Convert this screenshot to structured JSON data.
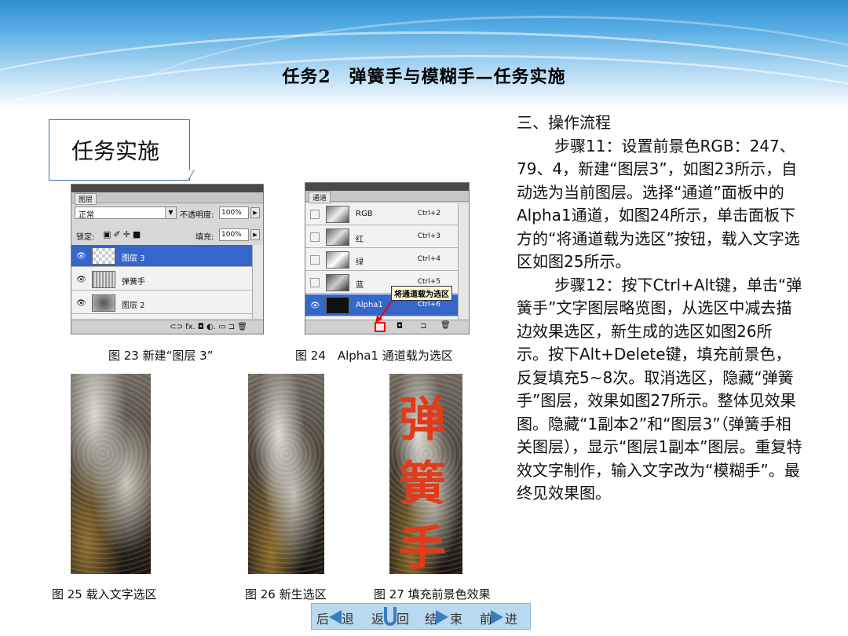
{
  "slide": {
    "title": "任务2　弹簧手与模糊手—任务实施",
    "callout": "任务实施"
  },
  "layers_panel": {
    "tab": "图层",
    "blend_mode": "正常",
    "opacity_label": "不透明度:",
    "opacity_value": "100%",
    "lock_label": "锁定:",
    "fill_label": "填充:",
    "fill_value": "100%",
    "layers": [
      {
        "name": "图层 3",
        "selected": true
      },
      {
        "name": "弹簧手",
        "selected": false
      },
      {
        "name": "图层 2",
        "selected": false
      }
    ],
    "bottom_icons": "⊂⊃ fx. ◘ ◐. ▭ ⊐ 🗑"
  },
  "channels_panel": {
    "tab": "通道",
    "channels": [
      {
        "name": "RGB",
        "shortcut": "Ctrl+2"
      },
      {
        "name": "红",
        "shortcut": "Ctrl+3"
      },
      {
        "name": "绿",
        "shortcut": "Ctrl+4"
      },
      {
        "name": "蓝",
        "shortcut": "Ctrl+5"
      },
      {
        "name": "Alpha1",
        "shortcut": "Ctrl+6",
        "selected": true
      }
    ],
    "tooltip": "将通道载为选区"
  },
  "captions": {
    "fig23": "图 23  新建“图层 3”",
    "fig24": "图 24　Alpha1 通道载为选区",
    "fig25": "图 25 载入文字选区",
    "fig26": "图 26 新生选区",
    "fig27": "图 27 填充前景色效果"
  },
  "fig27_chars": [
    "弹",
    "簧",
    "手"
  ],
  "body": {
    "heading": "三、操作流程",
    "step11": "步骤11：设置前景色RGB：247、79、4，新建“图层3”，如图23所示，自动选为当前图层。选择“通道”面板中的Alpha1通道，如图24所示，单击面板下方的“将通道载为选区”按钮，载入文字选区如图25所示。",
    "step12": "步骤12：按下Ctrl+Alt键，单击“弹簧手”文字图层略览图，从选区中减去描边效果选区，新生成的选区如图26所示。按下Alt+Delete键，填充前景色，反复填充5~8次。取消选区，隐藏“弹簧手”图层，效果如图27所示。整体见效果图。隐藏“1副本2”和“图层3”（弹簧手相关图层），显示“图层1副本”图层。重复特效文字制作，输入文字改为“模糊手”。最终见效果图。"
  },
  "nav": {
    "back": "后　退",
    "return": "返　回",
    "end": "结　束",
    "forward": "前　进"
  },
  "colors": {
    "fill_red": "#e23a1a",
    "selection_blue": "#3467c9"
  }
}
